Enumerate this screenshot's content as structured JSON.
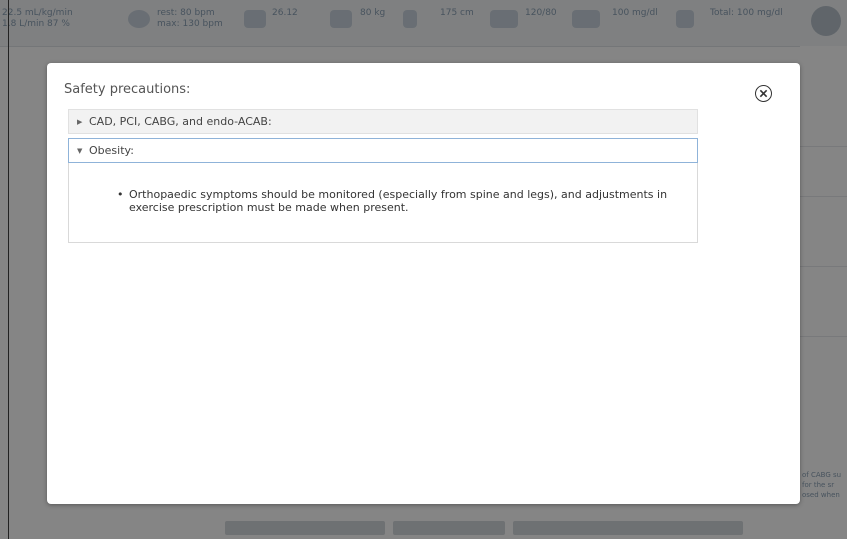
{
  "background": {
    "metrics": [
      {
        "icon": "gauge-icon",
        "line1": "22.5 mL/kg/min",
        "line2": "1.8 L/min 87 %"
      },
      {
        "icon": "heart-icon",
        "line1": "rest: 80 bpm",
        "line2": "max: 130 bpm"
      },
      {
        "icon": "bmi-icon",
        "line1": "26.12",
        "line2": ""
      },
      {
        "icon": "scale-icon",
        "line1": "80 kg",
        "line2": ""
      },
      {
        "icon": "height-icon",
        "line1": "175 cm",
        "line2": ""
      },
      {
        "icon": "blood-pressure-icon",
        "line1": "120/80",
        "line2": ""
      },
      {
        "icon": "glucose-icon",
        "line1": "100 mg/dl",
        "line2": ""
      },
      {
        "icon": "cholesterol-icon",
        "line1": "Total: 100 mg/dl",
        "line2": ""
      }
    ],
    "right_snippet": [
      "of CABG su",
      "for the sr",
      "osed when"
    ]
  },
  "modal": {
    "title": "Safety precautions:",
    "close_icon": "close-circle-icon",
    "sections": [
      {
        "label": "CAD, PCI, CABG, and endo-ACAB:",
        "expanded": false
      },
      {
        "label": "Obesity:",
        "expanded": true,
        "items": [
          "Orthopaedic symptoms should be monitored (especially from spine and legs), and adjustments in exercise prescription must be made when present."
        ]
      }
    ]
  }
}
